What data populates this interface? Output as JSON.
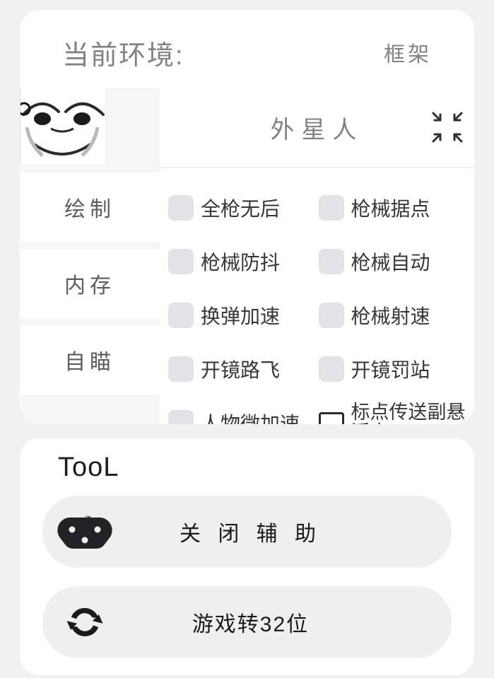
{
  "env": {
    "label": "当前环境:",
    "value": "框架"
  },
  "sidebar": {
    "tabs": [
      {
        "label": "绘制"
      },
      {
        "label": "内存"
      },
      {
        "label": "自瞄"
      }
    ]
  },
  "content": {
    "title": "外星人",
    "options": [
      {
        "label": "全枪无后"
      },
      {
        "label": "枪械据点"
      },
      {
        "label": "枪械防抖"
      },
      {
        "label": "枪械自动"
      },
      {
        "label": "换弹加速"
      },
      {
        "label": "枪械射速"
      },
      {
        "label": "开镜路飞"
      },
      {
        "label": "开镜罚站"
      },
      {
        "label": "人物微加速"
      },
      {
        "label": "标点传送副悬浮窗"
      }
    ]
  },
  "tool": {
    "title": "TooL",
    "buttons": [
      {
        "label": "关 闭 辅 助"
      },
      {
        "label": "游戏转32位"
      }
    ]
  }
}
